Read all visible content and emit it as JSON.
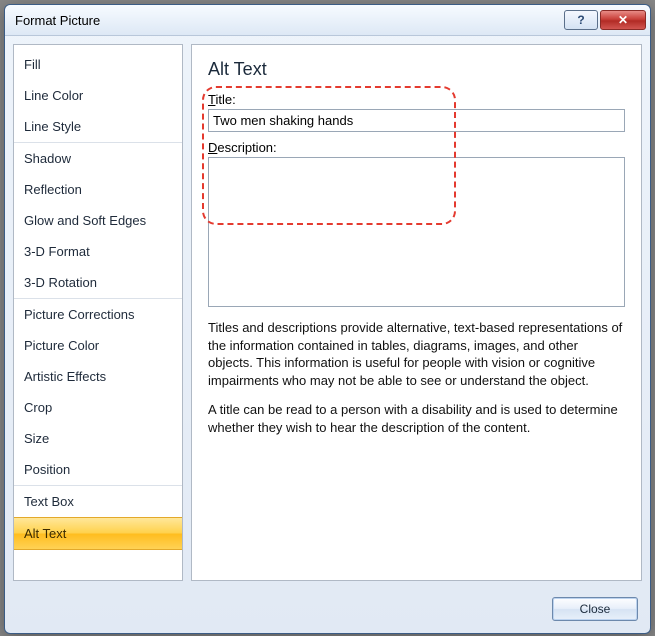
{
  "window": {
    "title": "Format Picture",
    "help_glyph": "?",
    "close_glyph": "✕"
  },
  "sidebar": {
    "items": [
      {
        "label": "Fill"
      },
      {
        "label": "Line Color"
      },
      {
        "label": "Line Style"
      },
      {
        "label": "Shadow"
      },
      {
        "label": "Reflection"
      },
      {
        "label": "Glow and Soft Edges"
      },
      {
        "label": "3-D Format"
      },
      {
        "label": "3-D Rotation"
      },
      {
        "label": "Picture Corrections"
      },
      {
        "label": "Picture Color"
      },
      {
        "label": "Artistic Effects"
      },
      {
        "label": "Crop"
      },
      {
        "label": "Size"
      },
      {
        "label": "Position"
      },
      {
        "label": "Text Box"
      },
      {
        "label": "Alt Text"
      }
    ],
    "selected_index": 15,
    "separator_indices": [
      3,
      8,
      14
    ]
  },
  "panel": {
    "heading": "Alt Text",
    "title_label_u": "T",
    "title_label_rest": "itle:",
    "title_value": "Two men shaking hands",
    "desc_label_u": "D",
    "desc_label_rest": "escription:",
    "desc_value": "",
    "help_p1": "Titles and descriptions provide alternative, text-based representations of the information contained in tables, diagrams, images, and other objects. This information is useful for people with vision or cognitive impairments who may not be able to see or understand the object.",
    "help_p2": "A title can be read to a person with a disability and is used to determine whether they wish to hear the description of the content."
  },
  "footer": {
    "close_label": "Close"
  }
}
